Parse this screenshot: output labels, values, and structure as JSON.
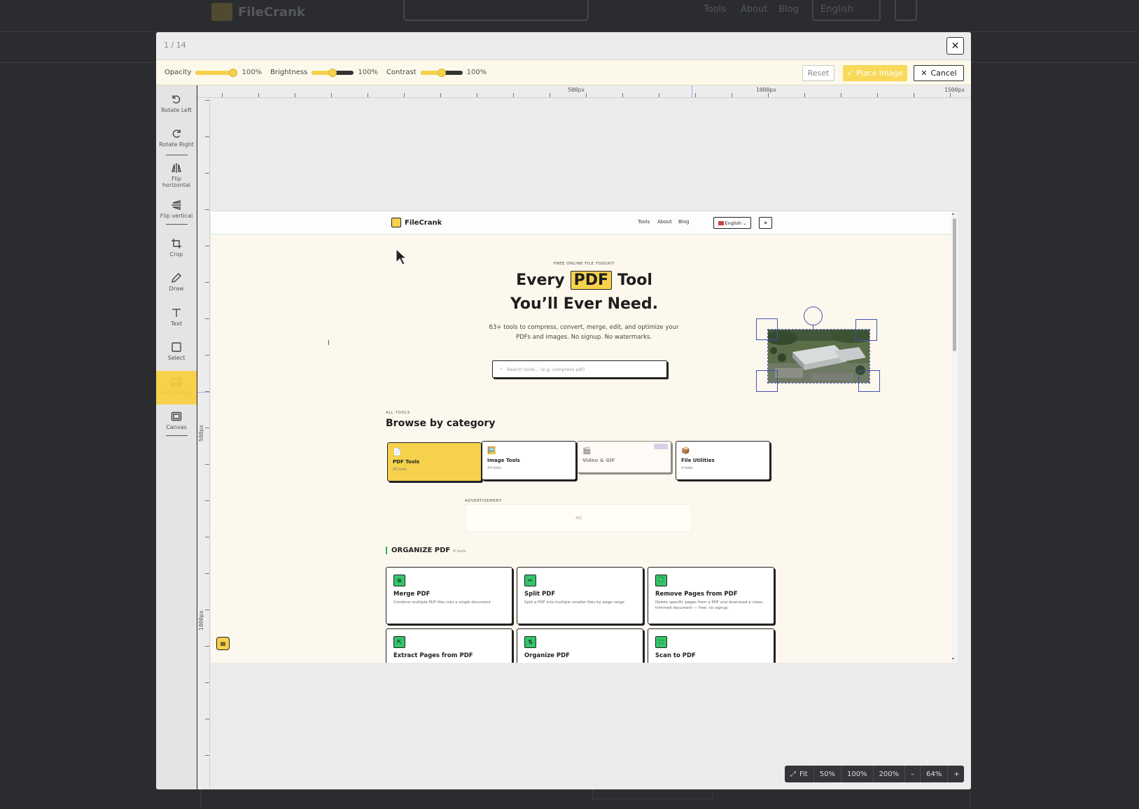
{
  "background": {
    "logo": "FileCrank",
    "nav": [
      "Tools",
      "About",
      "Blog"
    ],
    "language": "English"
  },
  "modal": {
    "page_counter": "1 / 14",
    "close_symbol": "✕"
  },
  "adjustments": {
    "opacity": {
      "label": "Opacity",
      "value": "100%",
      "level": 1.0
    },
    "brightness": {
      "label": "Brightness",
      "value": "100%",
      "level": 0.5
    },
    "contrast": {
      "label": "Contrast",
      "value": "100%",
      "level": 0.5
    },
    "reset_label": "Reset",
    "place_label": "Place Image",
    "cancel_label": "Cancel"
  },
  "tools": [
    {
      "label": "Rotate Left",
      "icon": "rotate-left-icon"
    },
    {
      "label": "Rotate Right",
      "icon": "rotate-right-icon"
    },
    {
      "label": "Flip horizontal",
      "icon": "flip-horizontal-icon"
    },
    {
      "label": "Flip vertical",
      "icon": "flip-vertical-icon"
    },
    {
      "label": "Crop",
      "icon": "crop-icon"
    },
    {
      "label": "Draw",
      "icon": "pencil-icon"
    },
    {
      "label": "Text",
      "icon": "text-icon"
    },
    {
      "label": "Select",
      "icon": "select-icon"
    },
    {
      "label": "Add image",
      "icon": "image-icon",
      "active": true
    },
    {
      "label": "Canvas",
      "icon": "canvas-icon"
    }
  ],
  "rulers": {
    "top": [
      "500px",
      "1000px",
      "1500px"
    ],
    "left": [
      "500px",
      "1000px"
    ]
  },
  "page": {
    "logo": "FileCrank",
    "nav": [
      "Tools",
      "About",
      "Blog"
    ],
    "language": "English",
    "hero": {
      "kicker": "FREE ONLINE FILE TOOLKIT",
      "line1_pre": "Every",
      "line1_highlight": "PDF",
      "line1_post": "Tool",
      "line2": "You’ll Ever Need.",
      "sub_line1": "63+ tools to compress, convert, merge, edit, and optimize your",
      "sub_line2": "PDFs and images. No signup. No watermarks.",
      "search_placeholder": "Search tools... (e.g. compress pdf)"
    },
    "all_tools": {
      "kicker": "ALL TOOLS",
      "title": "Browse by category",
      "categories": [
        {
          "icon": "📄",
          "name": "PDF Tools",
          "count": "33 tools"
        },
        {
          "icon": "🖼️",
          "name": "Image Tools",
          "count": "24 tools"
        },
        {
          "icon": "🎬",
          "name": "Video & GIF",
          "count": ""
        },
        {
          "icon": "📦",
          "name": "File Utilities",
          "count": "4 tools"
        }
      ]
    },
    "ad": {
      "label": "ADVERTISEMENT",
      "text": "AD"
    },
    "organize": {
      "title": "ORGANIZE PDF",
      "count": "8 tools",
      "cards": [
        {
          "name": "Merge PDF",
          "desc": "Combine multiple PDF files into a single document",
          "icon": "⧉"
        },
        {
          "name": "Split PDF",
          "desc": "Split a PDF into multiple smaller files by page range",
          "icon": "✂"
        },
        {
          "name": "Remove Pages from PDF",
          "desc": "Delete specific pages from a PDF and download a clean, trimmed document — free, no signup.",
          "icon": "🗋"
        },
        {
          "name": "Extract Pages from PDF",
          "desc": "",
          "icon": "⇱"
        },
        {
          "name": "Organize PDF",
          "desc": "",
          "icon": "⇅"
        },
        {
          "name": "Scan to PDF",
          "desc": "",
          "icon": "⛶"
        }
      ]
    }
  },
  "zoom": {
    "fit": "Fit",
    "presets": [
      "50%",
      "100%",
      "200%"
    ],
    "minus": "–",
    "current": "64%",
    "plus": "+"
  },
  "colors": {
    "accent": "#f6d24c",
    "handle": "#4251b2",
    "tool_icon_bg": "#34c46a"
  }
}
